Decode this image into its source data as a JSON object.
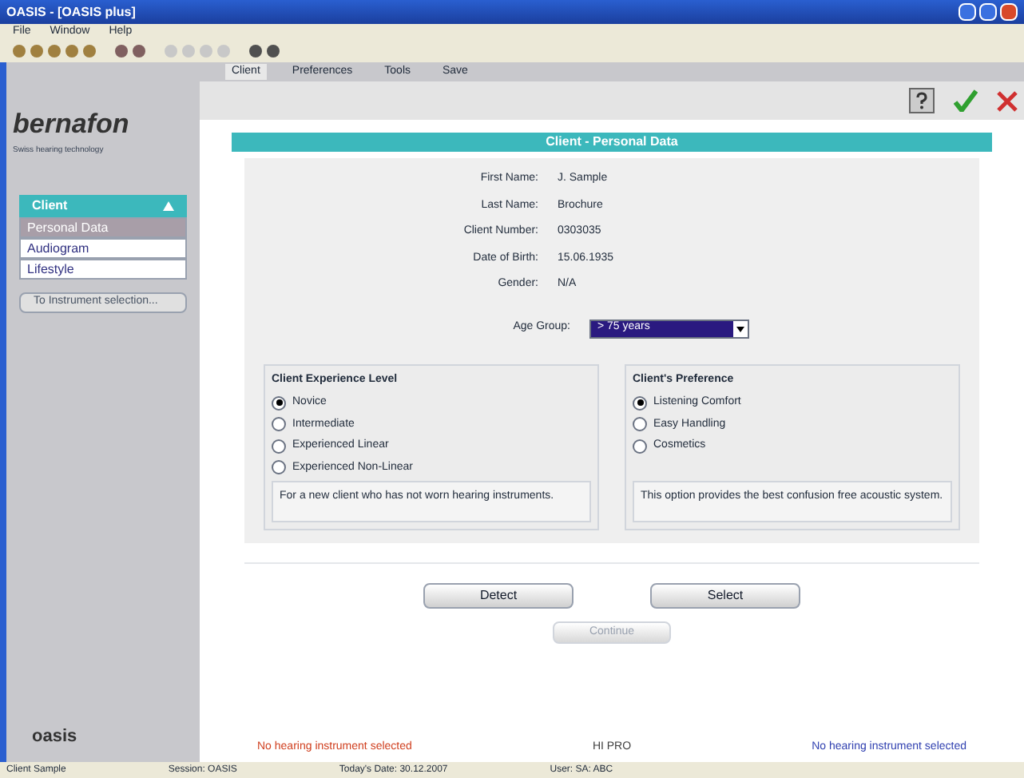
{
  "window": {
    "title": "OASIS - [OASIS plus]"
  },
  "menu": [
    "File",
    "Window",
    "Help"
  ],
  "tabs": [
    {
      "label": "Client",
      "selected": true
    },
    {
      "label": "Preferences",
      "selected": false
    },
    {
      "label": "Tools",
      "selected": false
    },
    {
      "label": "Save",
      "selected": false
    }
  ],
  "logo": {
    "name": "bernafon",
    "tagline": "Swiss hearing technology"
  },
  "sidebar": {
    "title": "Client",
    "items": [
      {
        "label": "Personal Data",
        "selected": true
      },
      {
        "label": "Audiogram",
        "selected": false
      },
      {
        "label": "Lifestyle",
        "selected": false
      }
    ],
    "button": "To Instrument selection..."
  },
  "panel": {
    "title": "Client - Personal Data",
    "fields": [
      {
        "label": "First Name:",
        "value": "J. Sample"
      },
      {
        "label": "Last Name:",
        "value": "Brochure"
      },
      {
        "label": "Client Number:",
        "value": "0303035"
      },
      {
        "label": "Date of Birth:",
        "value": "15.06.1935"
      },
      {
        "label": "Gender:",
        "value": "N/A"
      }
    ],
    "age_group": {
      "label": "Age Group:",
      "value": "> 75 years"
    },
    "groups": [
      {
        "title": "Client Experience Level",
        "options": [
          {
            "label": "Novice",
            "selected": true
          },
          {
            "label": "Intermediate",
            "selected": false
          },
          {
            "label": "Experienced Linear",
            "selected": false
          },
          {
            "label": "Experienced Non-Linear",
            "selected": false
          }
        ],
        "description": "For a new client who has not worn hearing instruments."
      },
      {
        "title": "Client's Preference",
        "options": [
          {
            "label": "Listening Comfort",
            "selected": true
          },
          {
            "label": "Easy Handling",
            "selected": false
          },
          {
            "label": "Cosmetics",
            "selected": false
          }
        ],
        "description": "This option provides the best confusion free acoustic system."
      }
    ]
  },
  "buttons": [
    {
      "label": "Detect",
      "disabled": false
    },
    {
      "label": "Select",
      "disabled": false
    },
    {
      "label": "Continue",
      "disabled": true
    }
  ],
  "messages": [
    {
      "text": "No hearing instrument selected",
      "color": "#d04020"
    },
    {
      "text": "HI PRO",
      "color": "#404040"
    },
    {
      "text": "No hearing instrument selected",
      "color": "#3040b0"
    }
  ],
  "footer_logo": "oasis",
  "status_bar": [
    "Client Sample",
    "Session: OASIS",
    "Today's Date: 30.12.2007",
    "User: SA: ABC"
  ]
}
